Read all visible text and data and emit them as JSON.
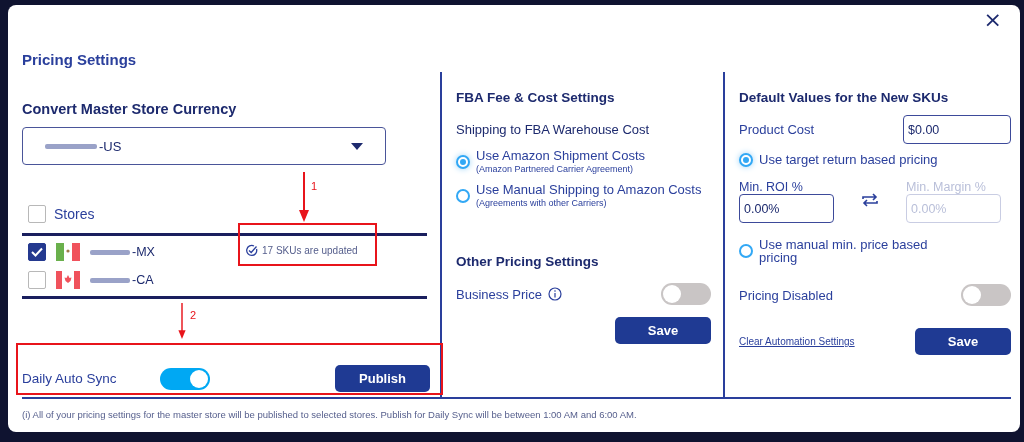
{
  "dialog": {
    "title": "Pricing Settings",
    "close": "×"
  },
  "left": {
    "currency_heading": "Convert Master Store Currency",
    "master_store": {
      "name": "-US",
      "name_redacted": true
    },
    "stores_header": {
      "label": "Stores",
      "checked": false
    },
    "stores": [
      {
        "name": "-MX",
        "name_redacted": true,
        "kind": "mexico",
        "checked": true,
        "status": "17 SKUs are updated"
      },
      {
        "name": "-CA",
        "name_redacted": true,
        "kind": "canada",
        "checked": false
      }
    ],
    "daily_auto_sync": {
      "label": "Daily Auto Sync",
      "on": true
    },
    "publish_button": "Publish"
  },
  "middle": {
    "heading": "FBA Fee & Cost Settings",
    "subheading": "Shipping to FBA Warehouse Cost",
    "options": [
      {
        "label": "Use Amazon Shipment Costs",
        "note": "(Amazon Partnered Carrier Agreement)",
        "selected": true
      },
      {
        "label": "Use Manual Shipping to Amazon Costs",
        "note": "(Agreements with other Carriers)",
        "selected": false
      }
    ],
    "other_heading": "Other Pricing Settings",
    "business_price": {
      "label": "Business Price",
      "on": false
    },
    "save_button": "Save"
  },
  "right": {
    "heading": "Default Values for the New SKUs",
    "product_cost": {
      "label": "Product Cost",
      "value": "$0.00"
    },
    "target_option": {
      "label": "Use target return based pricing",
      "selected": true
    },
    "min_roi": {
      "label": "Min. ROI %",
      "value": "0.00%",
      "disabled": false
    },
    "min_margin": {
      "label": "Min. Margin %",
      "value": "0.00%",
      "disabled": true
    },
    "manual_option": {
      "label": "Use manual min. price based pricing",
      "selected": false
    },
    "pricing_disabled": {
      "label": "Pricing Disabled",
      "on": false
    },
    "clear_link": "Clear Automation Settings",
    "save_button": "Save"
  },
  "footnote": "(i) All of your pricing settings for the master store will be published to selected stores. Publish for Daily Sync will be between 1:00 AM and 6:00 AM.",
  "annotations": [
    {
      "label": "1"
    },
    {
      "label": "2"
    }
  ]
}
